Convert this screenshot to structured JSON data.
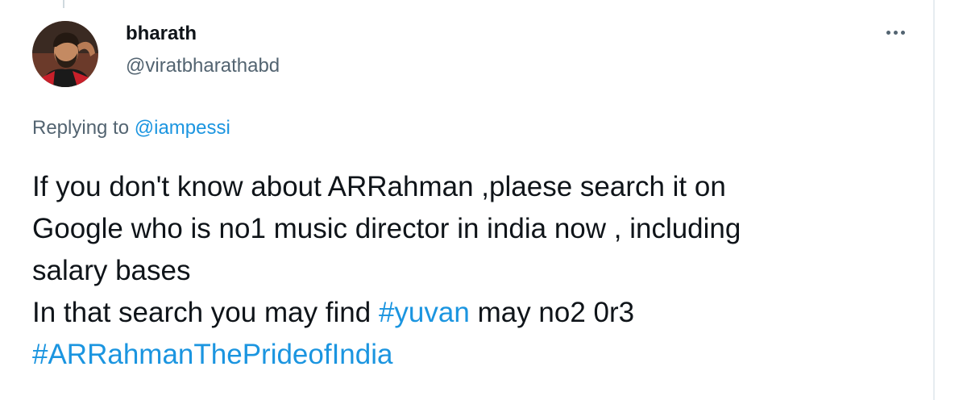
{
  "author": {
    "name": "bharath",
    "handle": "@viratbharathabd"
  },
  "reply": {
    "prefix": "Replying to",
    "mention": "@iampessi"
  },
  "tweet": {
    "line1": "If you don't know about ARRahman ,plaese search it on",
    "line2": "Google who is no1 music director in india now , including",
    "line3": "salary bases",
    "line4_prefix": "In that search you may find",
    "line4_hashtag": "#yuvan",
    "line4_suffix": "may no2 0r3",
    "line5_hashtag": "#ARRahmanThePrideofIndia"
  },
  "icons": {
    "more": "more-horizontal-icon",
    "avatar": "user-avatar"
  },
  "colors": {
    "link": "#1b95e0",
    "secondary_text": "#536471",
    "primary_text": "#0f1419"
  }
}
